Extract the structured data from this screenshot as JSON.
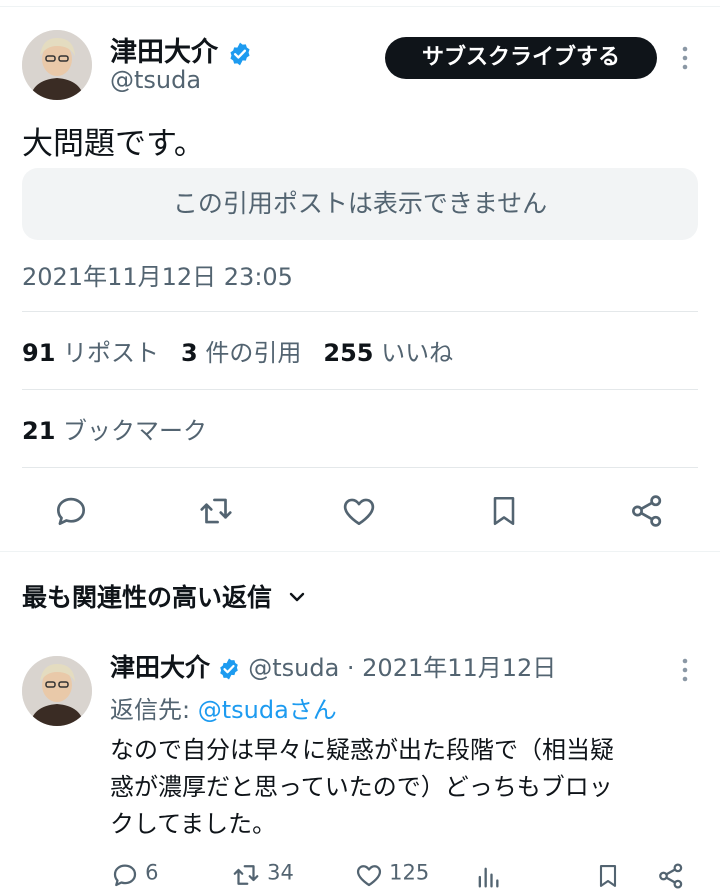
{
  "tweet": {
    "author_name": "津田大介",
    "author_handle": "@tsuda",
    "subscribe_label": "サブスクライブする",
    "text": "大問題です。",
    "quote_unavailable": "この引用ポストは表示できません",
    "timestamp": "2021年11月12日 23:05",
    "stats": {
      "reposts_count": "91",
      "reposts_label": "リポスト",
      "quotes_count": "3",
      "quotes_label": "件の引用",
      "likes_count": "255",
      "likes_label": "いいね",
      "bookmarks_count": "21",
      "bookmarks_label": "ブックマーク"
    },
    "actions": [
      "reply-icon",
      "repost-icon",
      "like-icon",
      "bookmark-icon",
      "share-icon"
    ]
  },
  "replies_section": {
    "header": "最も関連性の高い返信"
  },
  "reply": {
    "author_name": "津田大介",
    "meta": "@tsuda · 2021年11月12日",
    "reply_to_prefix": "返信先: ",
    "reply_to_mention": "@tsudaさん",
    "text_line1": "なので自分は早々に疑惑が出た段階で（相当疑",
    "text_line2": "惑が濃厚だと思っていたので）どっちもブロッ",
    "text_line3": "クしてました。",
    "metrics": {
      "replies": "6",
      "reposts": "34",
      "likes": "125"
    }
  },
  "colors": {
    "verified_blue": "#1d9bf0",
    "text_primary": "#0f1419",
    "text_secondary": "#536471"
  }
}
